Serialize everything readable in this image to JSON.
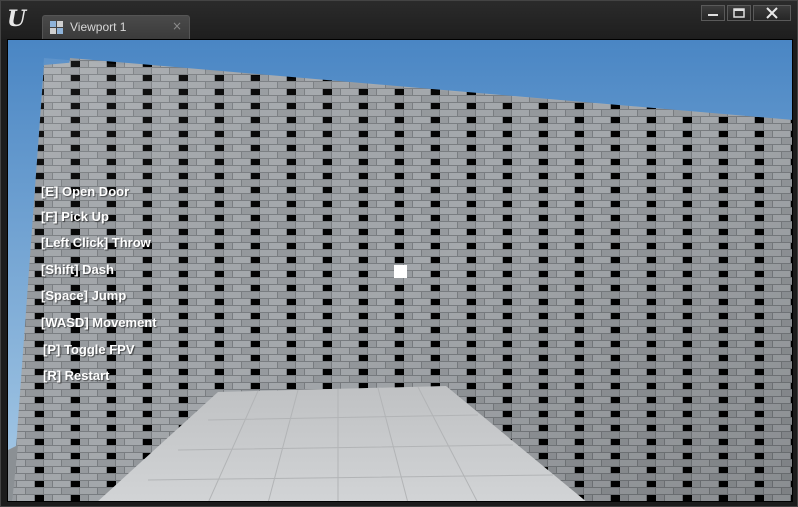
{
  "window": {
    "logo_text": "U",
    "tab": {
      "label": "Viewport 1",
      "close_glyph": "×",
      "icon": "viewport-grid-icon"
    },
    "controls": {
      "minimize_glyph": "minimize-icon",
      "maximize_glyph": "maximize-icon",
      "close_glyph": "close-icon"
    }
  },
  "hud": {
    "controls": [
      {
        "key": "[E]",
        "action": "Open Door"
      },
      {
        "key": "[F]",
        "action": "Pick Up"
      },
      {
        "key": "[Left Click]",
        "action": "Throw"
      },
      {
        "key": "[Shift]",
        "action": "Dash"
      },
      {
        "key": "[Space]",
        "action": "Jump"
      },
      {
        "key": "[WASD]",
        "action": "Movement"
      },
      {
        "key": "[P]",
        "action": "Toggle FPV"
      },
      {
        "key": "[R]",
        "action": "Restart"
      }
    ]
  },
  "colors": {
    "sky_top": "#4a86c4",
    "sky_bottom": "#a9cbe6",
    "wall": "#9a9ea2",
    "floor": "#c4c6c8",
    "hud_text": "#ffffff",
    "crosshair": "#ffffff"
  }
}
